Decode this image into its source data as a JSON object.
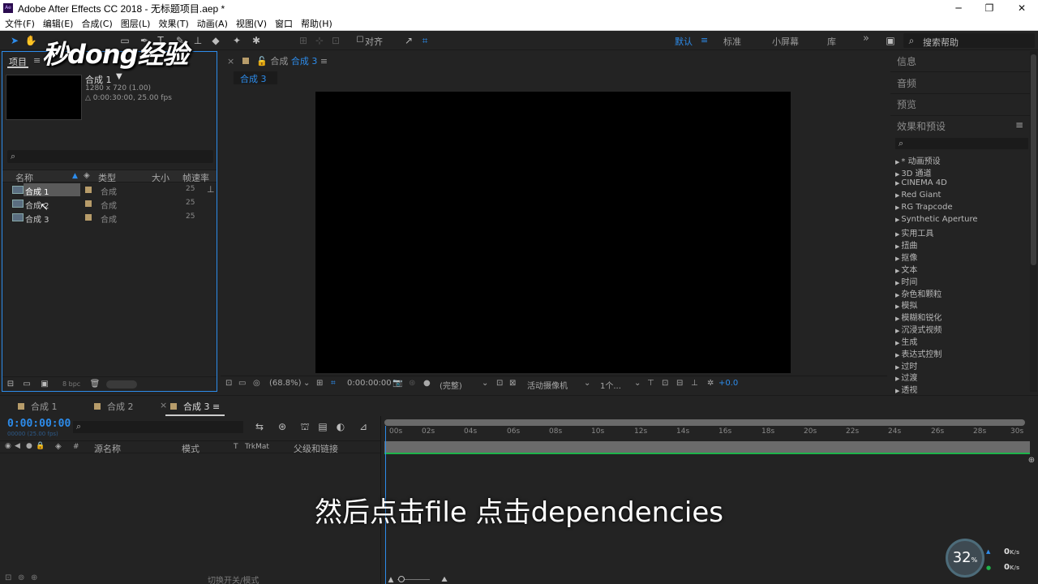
{
  "window": {
    "title": "Adobe After Effects CC 2018 - 无标题项目.aep *",
    "logo_text": "Ae",
    "controls": {
      "minimize": "─",
      "maximize": "❐",
      "close": "✕"
    }
  },
  "menu": [
    "文件(F)",
    "编辑(E)",
    "合成(C)",
    "图层(L)",
    "效果(T)",
    "动画(A)",
    "视图(V)",
    "窗口",
    "帮助(H)"
  ],
  "toolbar": {
    "align_label": "对齐",
    "workspaces": [
      "默认",
      "标准",
      "小屏幕",
      "库"
    ],
    "more": "»",
    "search_placeholder": "搜索帮助"
  },
  "watermark": "秒dong经验",
  "project": {
    "tab_label": "项目",
    "selected_comp": {
      "name": "合成 1",
      "dimensions": "1280 x 720 (1.00)",
      "duration": "△ 0:00:30:00, 25.00 fps"
    },
    "search_icon": "⌕",
    "columns": {
      "name": "名称",
      "type": "类型",
      "size": "大小",
      "fps": "帧速率"
    },
    "items": [
      {
        "name": "合成 1",
        "type": "合成",
        "fps": "25"
      },
      {
        "name": "合成 2",
        "type": "合成",
        "fps": "25"
      },
      {
        "name": "合成 3",
        "type": "合成",
        "fps": "25"
      }
    ],
    "bpc": "8 bpc"
  },
  "composition": {
    "tab_prefix": "合成",
    "tab_name": "合成 3",
    "sub_tab": "合成 3",
    "zoom": "(68.8%)",
    "timecode": "0:00:00:00",
    "quality": "(完整)",
    "camera": "活动摄像机",
    "views": "1个...",
    "exposure": "+0.0"
  },
  "right_panel": {
    "info": "信息",
    "audio": "音频",
    "preview": "预览",
    "effects_title": "效果和预设",
    "effects": [
      "* 动画预设",
      "3D 通道",
      "CINEMA 4D",
      "Red Giant",
      "RG Trapcode",
      "Synthetic Aperture",
      "实用工具",
      "扭曲",
      "抠像",
      "文本",
      "时间",
      "杂色和颗粒",
      "模拟",
      "模糊和锐化",
      "沉浸式视频",
      "生成",
      "表达式控制",
      "过时",
      "过渡",
      "透视"
    ]
  },
  "timeline": {
    "tabs": [
      "合成 1",
      "合成 2",
      "合成 3"
    ],
    "timecode": "0:00:00:00",
    "subtime": "00000 (25.00 fps)",
    "columns": {
      "hash": "#",
      "source": "源名称",
      "mode": "模式",
      "t": "T",
      "trkmat": "TrkMat",
      "parent": "父级和链接"
    },
    "ruler": [
      "00s",
      "02s",
      "04s",
      "06s",
      "08s",
      "10s",
      "12s",
      "14s",
      "16s",
      "18s",
      "20s",
      "22s",
      "24s",
      "26s",
      "28s",
      "30s"
    ],
    "footer": "切换开关/模式"
  },
  "subtitle": "然后点击file  点击dependencies",
  "speed_widget": {
    "value": "32",
    "unit": "%",
    "up": "0",
    "down": "0",
    "rate_unit": "K/s"
  },
  "colors": {
    "accent": "#2d8ceb",
    "panel": "#232323",
    "label": "#b79c6a",
    "green": "#1eb34a"
  }
}
